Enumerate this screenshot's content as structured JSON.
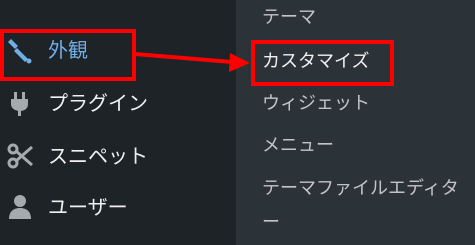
{
  "sidebar": {
    "items": [
      {
        "label": "外観",
        "icon": "paintbrush-icon",
        "active": true
      },
      {
        "label": "プラグイン",
        "icon": "plugin-icon"
      },
      {
        "label": "スニペット",
        "icon": "scissors-icon"
      },
      {
        "label": "ユーザー",
        "icon": "user-icon"
      }
    ]
  },
  "submenu": {
    "items": [
      {
        "label": "テーマ"
      },
      {
        "label": "カスタマイズ",
        "highlighted": true
      },
      {
        "label": "ウィジェット"
      },
      {
        "label": "メニュー"
      },
      {
        "label": "テーマファイルエディター"
      }
    ]
  },
  "colors": {
    "sidebar_bg": "#1d2327",
    "submenu_bg": "#2c3338",
    "accent": "#72aee6",
    "annotation": "#ff0000"
  }
}
